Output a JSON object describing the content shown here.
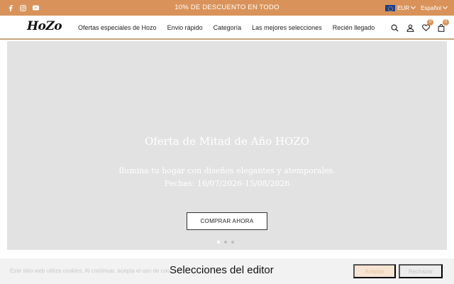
{
  "topbar": {
    "promo": "10% DE DESCUENTO EN TODO",
    "social": [
      "facebook-icon",
      "instagram-icon",
      "youtube-icon"
    ],
    "currency": "EUR",
    "language": "Español"
  },
  "header": {
    "logo": "HoZo",
    "nav": [
      "Ofertas especiales de Hozo",
      "Envio rápido",
      "Categoría",
      "Las mejores selecciones",
      "Recién llegado"
    ],
    "wishlist_count": "0",
    "cart_count": "0"
  },
  "hero": {
    "title": "Oferta de Mitad de Año HOZO",
    "subtitle": "Ilumina tu hogar con diseños elegantes y atemporales.",
    "dates": "Fechas: 16/07/2026-15/08/2026",
    "cta": "COMPRAR AHORA",
    "slides": 3,
    "active_slide": 1
  },
  "cookie": {
    "text": "Este sitio web utiliza cookies. Al continuar, acepta el uso de cookies.",
    "accept": "Aceptar",
    "reject": "Rechazar"
  },
  "section": {
    "title": "Selecciones del editor"
  },
  "colors": {
    "brand": "#d9935a",
    "hero_bg": "#e2e2e2"
  }
}
